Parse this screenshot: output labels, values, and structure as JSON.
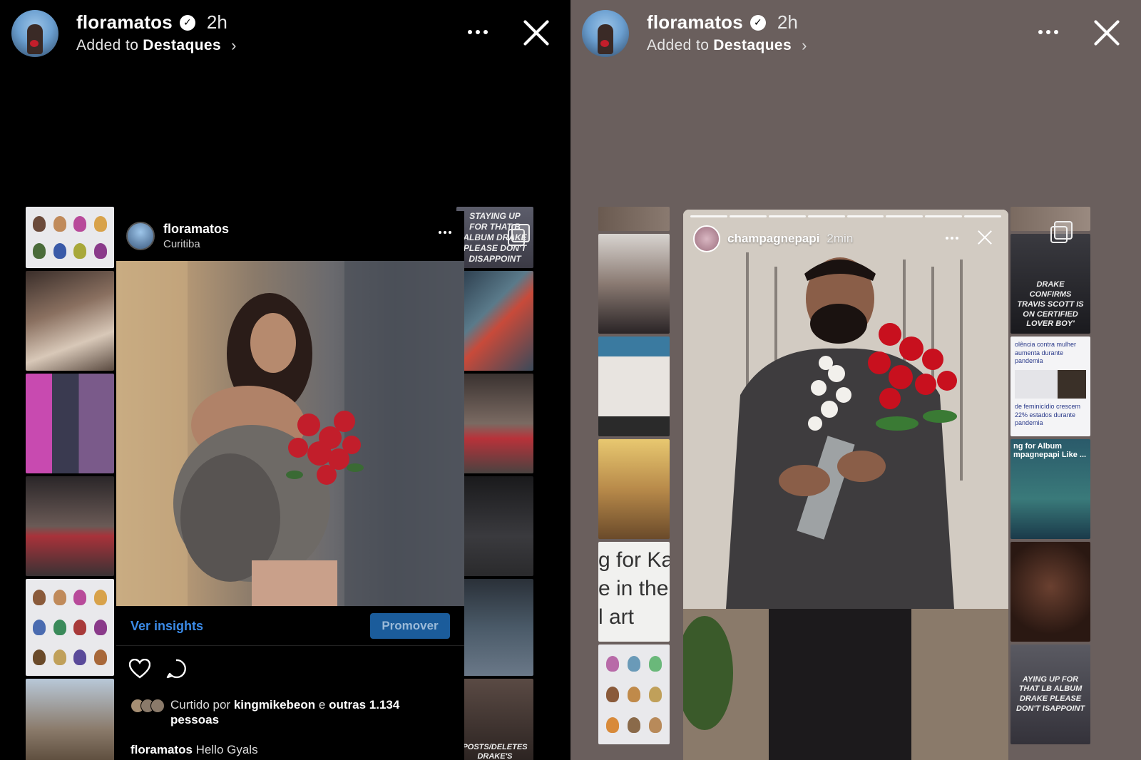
{
  "left_story": {
    "username": "floramatos",
    "time": "2h",
    "added_prefix": "Added to",
    "highlight": "Destaques",
    "post": {
      "username": "floramatos",
      "location": "Curitiba",
      "insights_label": "Ver insights",
      "promote_label": "Promover",
      "liked_prefix": "Curtido por",
      "liked_user": "kingmikebeon",
      "liked_suffix": "e",
      "liked_others": "outras 1.134",
      "liked_people": "pessoas",
      "caption_user": "floramatos",
      "caption_text": "Hello Gyals"
    },
    "collage_headlines": {
      "top_right": "STAYING UP FOR THAT B ALBUM DRAKE PLEASE DON'T DISAPPOINT",
      "bottom_right": "POSTS/DELETES DRAKE'S"
    }
  },
  "right_story": {
    "username": "floramatos",
    "time": "2h",
    "added_prefix": "Added to",
    "highlight": "Destaques",
    "embed": {
      "username": "champagnepapi",
      "time": "2min"
    },
    "collage_headlines": {
      "drake_confirms": "DRAKE CONFIRMS TRAVIS SCOTT IS ON CERTIFIED LOVER BOY'",
      "feminicidio_1": "olência contra mulher aumenta durante pandemia",
      "feminicidio_2": "de feminicídio crescem 22% estados durante pandemia",
      "album_line": "ng for Album mpagnepapi Like ...",
      "staying_up": "AYING UP FOR THAT LB ALBUM DRAKE PLEASE DON'T ISAPPOINT",
      "ka_lines": [
        "g for Ka",
        "e in the",
        "l art"
      ]
    }
  },
  "colors": {
    "link_blue": "#3b8ae6",
    "promote_bg": "#1b5c9b",
    "rose_red": "#c21e2b"
  }
}
